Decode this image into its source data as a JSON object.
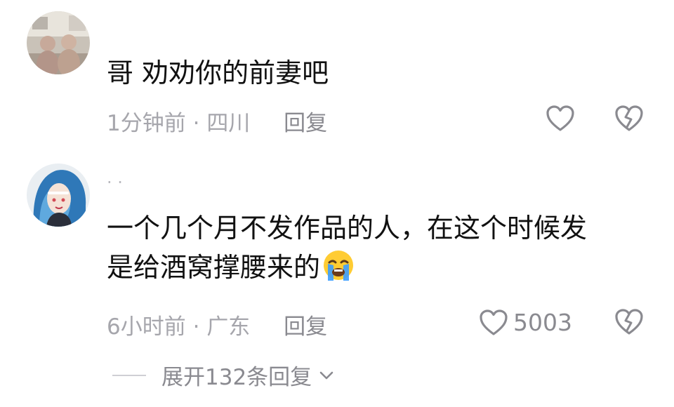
{
  "comments": [
    {
      "avatar": "photo-avatar-two-children",
      "text": [
        "哥 劝劝你的前妻吧"
      ],
      "time": "1分钟前",
      "location": "四川",
      "reply_label": "回复",
      "like_count": "",
      "like_icon": "heart-outline-icon",
      "dislike_icon": "broken-heart-icon"
    },
    {
      "avatar": "anime-avatar-blue-hair",
      "nickname": "· ·",
      "text": [
        "一个几个月不发作品的人，在这个时候发",
        "是给酒窝撑腰来的"
      ],
      "emoji": "crying-face-emoji",
      "time": "6小时前",
      "location": "广东",
      "reply_label": "回复",
      "like_count": "5003",
      "like_icon": "heart-outline-icon",
      "dislike_icon": "broken-heart-icon",
      "expand_label": "展开132条回复"
    }
  ],
  "colors": {
    "text": "#111111",
    "meta": "#a6a6ac",
    "icon": "#8a8a90"
  }
}
